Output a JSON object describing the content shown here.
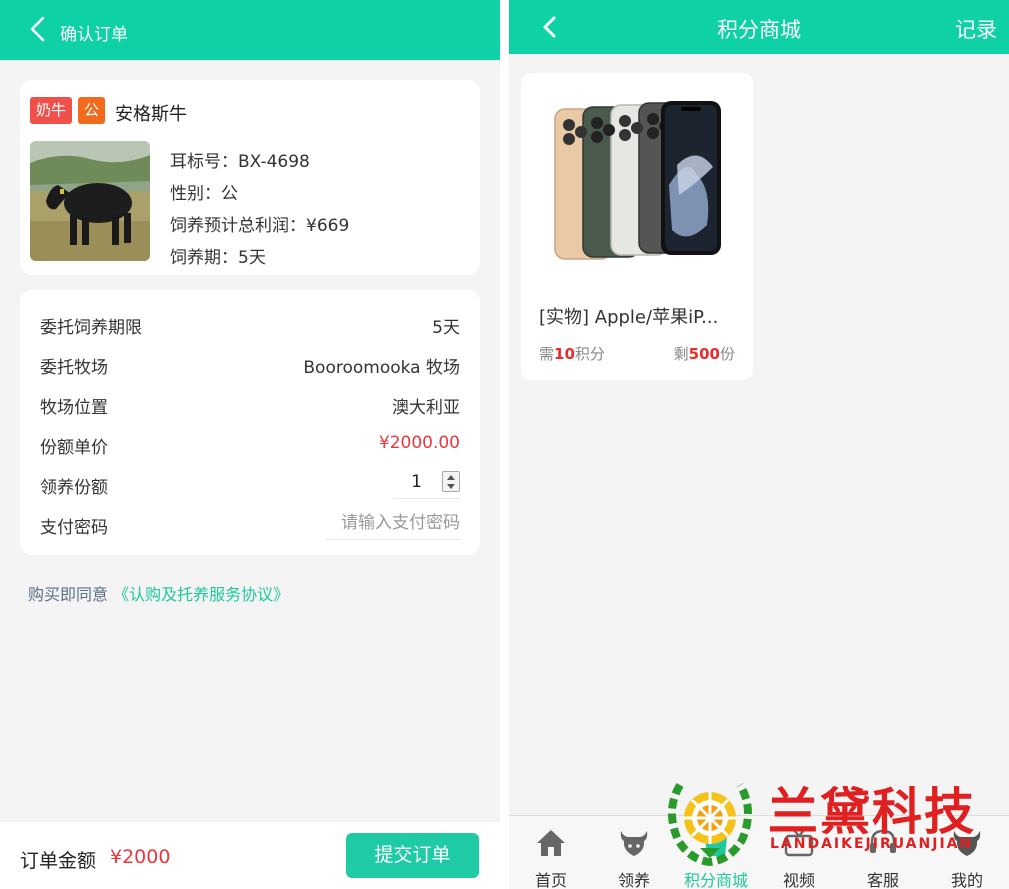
{
  "order": {
    "header_title": "确认订单",
    "tags": {
      "category": "奶牛",
      "gender": "公"
    },
    "cow_name": "安格斯牛",
    "ear_tag": "耳标号：BX-4698",
    "gender_line": "性别：公",
    "profit_line": "饲养预计总利润：¥669",
    "period_line": "饲养期：5天",
    "rows": [
      {
        "label": "委托饲养期限",
        "value": "5天"
      },
      {
        "label": "委托牧场",
        "value": "Booroomooka 牧场"
      },
      {
        "label": "牧场位置",
        "value": "澳大利亚"
      },
      {
        "label": "份额单价",
        "value": "¥2000.00"
      },
      {
        "label": "领养份额",
        "value": "1"
      },
      {
        "label": "支付密码",
        "placeholder": "请输入支付密码"
      }
    ],
    "agreement_text": "购买即同意",
    "agreement_link": "《认购及托养服务协议》",
    "total_label": "订单金额",
    "total_value": "¥2000",
    "submit_label": "提交订单"
  },
  "mall": {
    "header_title": "积分商城",
    "record_label": "记录",
    "product": {
      "title": "[实物] Apple/苹果iP...",
      "need_prefix": "需",
      "need_points": "10",
      "need_suffix": "积分",
      "left_prefix": "剩",
      "left_count": "500",
      "left_suffix": "份"
    },
    "tabs": [
      {
        "label": "首页",
        "icon": "home-icon"
      },
      {
        "label": "领养",
        "icon": "cow-icon"
      },
      {
        "label": "积分商城",
        "icon": "mall-icon",
        "active": true
      },
      {
        "label": "视频",
        "icon": "tv-icon"
      },
      {
        "label": "客服",
        "icon": "headset-icon"
      },
      {
        "label": "我的",
        "icon": "profile-icon"
      }
    ]
  },
  "watermark": {
    "title": "兰黛科技",
    "subtitle": "LANDAIKEJIRUANJIAN"
  },
  "colors": {
    "accent": "#0fd1a6",
    "price_red": "#e8383d",
    "tag_red": "#f0504a",
    "tag_orange": "#f26a1b"
  }
}
